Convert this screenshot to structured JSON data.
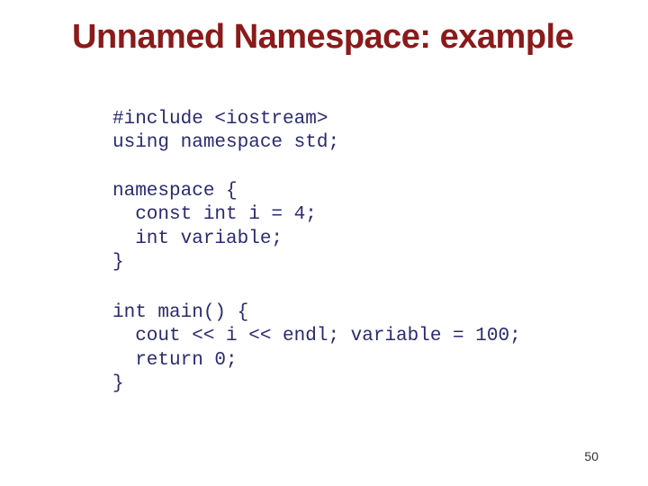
{
  "title": "Unnamed Namespace: example",
  "code": {
    "block1": "#include <iostream>\nusing namespace std;",
    "block2": "namespace {\n  const int i = 4;\n  int variable;\n}",
    "block3": "int main() {\n  cout << i << endl; variable = 100;\n  return 0;\n}"
  },
  "pageNumber": "50"
}
